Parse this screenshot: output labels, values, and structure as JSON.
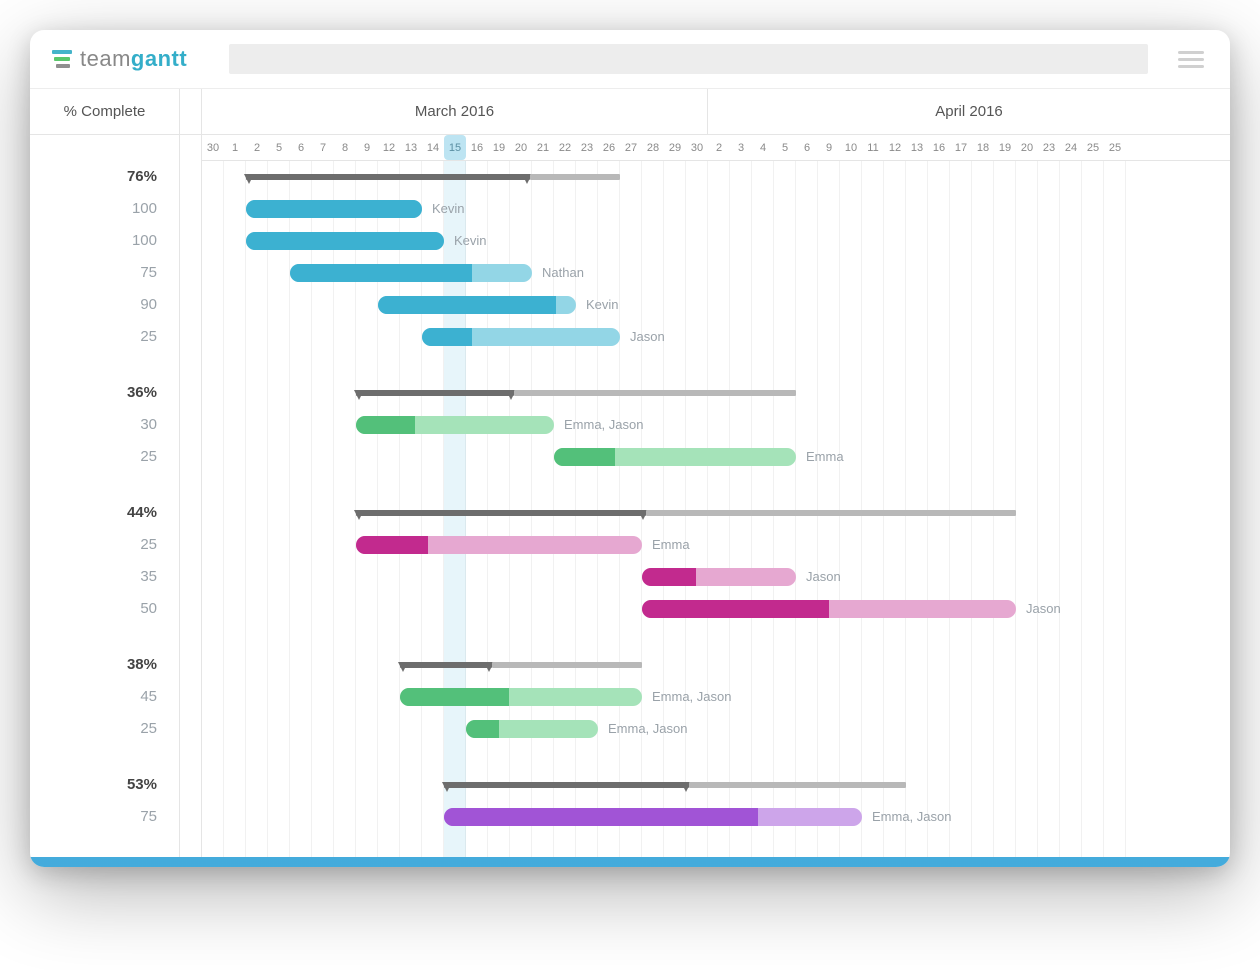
{
  "brand": {
    "text_a": "team",
    "text_b": "gantt"
  },
  "header": {
    "pct_label": "% Complete",
    "months": [
      "March 2016",
      "April 2016"
    ]
  },
  "timeline": {
    "day_width": 22,
    "days": [
      30,
      1,
      2,
      5,
      6,
      7,
      8,
      9,
      12,
      13,
      14,
      15,
      16,
      19,
      20,
      21,
      22,
      23,
      26,
      27,
      28,
      29,
      30,
      2,
      3,
      4,
      5,
      6,
      9,
      10,
      11,
      12,
      13,
      16,
      17,
      18,
      19,
      20,
      23,
      24,
      25,
      25
    ],
    "month_split_index": 23,
    "today_index": 11
  },
  "colors": {
    "blue": {
      "full": "#3cb1d1",
      "light": "#93d6e6"
    },
    "green": {
      "full": "#53c07a",
      "light": "#a5e3b9"
    },
    "magenta": {
      "full": "#c22a8e",
      "light": "#e6a8d1"
    },
    "purple": {
      "full": "#a154d6",
      "light": "#cda5ea"
    }
  },
  "chart_data": {
    "type": "bar",
    "title": "",
    "xlabel": "",
    "ylabel": "",
    "groups": [
      {
        "summary": {
          "pct": "76%",
          "start": 2,
          "end": 19,
          "progress": 76
        },
        "tasks": [
          {
            "pct": "100",
            "color": "blue",
            "start": 2,
            "end": 10,
            "progress": 100,
            "assignee": "Kevin"
          },
          {
            "pct": "100",
            "color": "blue",
            "start": 2,
            "end": 11,
            "progress": 100,
            "assignee": "Kevin"
          },
          {
            "pct": "75",
            "color": "blue",
            "start": 4,
            "end": 15,
            "progress": 75,
            "assignee": "Nathan"
          },
          {
            "pct": "90",
            "color": "blue",
            "start": 8,
            "end": 17,
            "progress": 90,
            "assignee": "Kevin"
          },
          {
            "pct": "25",
            "color": "blue",
            "start": 10,
            "end": 19,
            "progress": 25,
            "assignee": "Jason"
          }
        ]
      },
      {
        "summary": {
          "pct": "36%",
          "start": 7,
          "end": 27,
          "progress": 36
        },
        "tasks": [
          {
            "pct": "30",
            "color": "green",
            "start": 7,
            "end": 16,
            "progress": 30,
            "assignee": "Emma, Jason"
          },
          {
            "pct": "25",
            "color": "green",
            "start": 16,
            "end": 27,
            "progress": 25,
            "assignee": "Emma"
          }
        ]
      },
      {
        "summary": {
          "pct": "44%",
          "start": 7,
          "end": 37,
          "progress": 44
        },
        "tasks": [
          {
            "pct": "25",
            "color": "magenta",
            "start": 7,
            "end": 20,
            "progress": 25,
            "assignee": "Emma"
          },
          {
            "pct": "35",
            "color": "magenta",
            "start": 20,
            "end": 27,
            "progress": 35,
            "assignee": "Jason"
          },
          {
            "pct": "50",
            "color": "magenta",
            "start": 20,
            "end": 37,
            "progress": 50,
            "assignee": "Jason"
          }
        ]
      },
      {
        "summary": {
          "pct": "38%",
          "start": 9,
          "end": 20,
          "progress": 38
        },
        "tasks": [
          {
            "pct": "45",
            "color": "green",
            "start": 9,
            "end": 20,
            "progress": 45,
            "assignee": "Emma, Jason"
          },
          {
            "pct": "25",
            "color": "green",
            "start": 12,
            "end": 18,
            "progress": 25,
            "assignee": "Emma, Jason"
          }
        ]
      },
      {
        "summary": {
          "pct": "53%",
          "start": 11,
          "end": 32,
          "progress": 53
        },
        "tasks": [
          {
            "pct": "75",
            "color": "purple",
            "start": 11,
            "end": 30,
            "progress": 75,
            "assignee": "Emma, Jason"
          }
        ]
      }
    ]
  }
}
